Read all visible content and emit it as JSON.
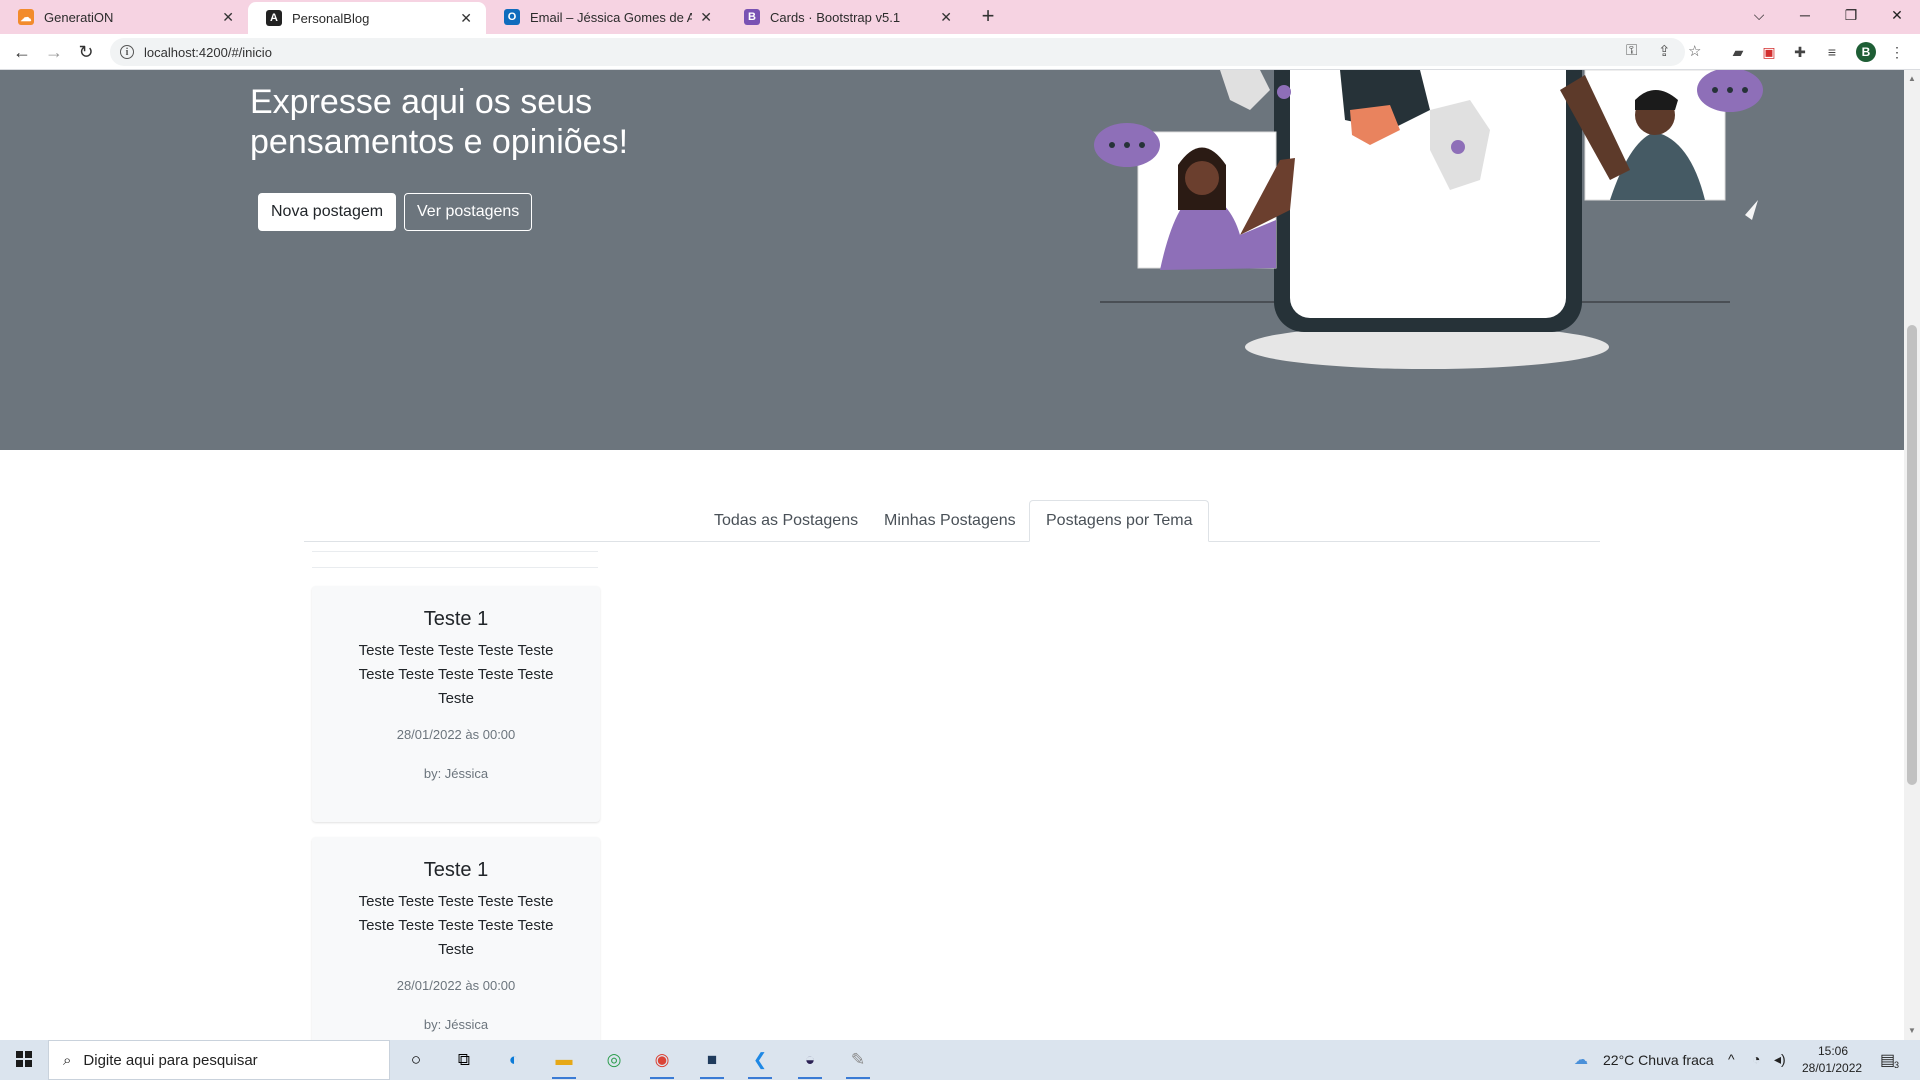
{
  "browser": {
    "tabs": [
      {
        "title": "GeneratiON",
        "icon": "cloud-icon",
        "color": "#f28b2c"
      },
      {
        "title": "PersonalBlog",
        "icon": "angular-icon",
        "color": "#222222"
      },
      {
        "title": "Email – Jéssica Gomes de Almeida",
        "icon": "outlook-icon",
        "color": "#0f6cbd"
      },
      {
        "title": "Cards · Bootstrap v5.1",
        "icon": "bootstrap-icon",
        "color": "#7952b3"
      }
    ],
    "url": "localhost:4200/#/inicio",
    "profile_initial": "B",
    "accent": "#f6d3e2"
  },
  "hero": {
    "title": "Expresse aqui os seus pensamentos e opiniões!",
    "primary_button": "Nova postagem",
    "secondary_button": "Ver postagens",
    "background": "#6c757d"
  },
  "tabs_nav": {
    "items": [
      "Todas as Postagens",
      "Minhas Postagens",
      "Postagens por Tema"
    ],
    "active": "Postagens por Tema"
  },
  "posts": [
    {
      "title": "Teste 1",
      "text": "Teste Teste Teste Teste Teste Teste Teste Teste Teste Teste Teste",
      "date": "28/01/2022 às 00:00",
      "author": "by: Jéssica"
    },
    {
      "title": "Teste 1",
      "text": "Teste Teste Teste Teste Teste Teste Teste Teste Teste Teste Teste",
      "date": "28/01/2022 às 00:00",
      "author": "by: Jéssica"
    }
  ],
  "taskbar": {
    "search_placeholder": "Digite aqui para pesquisar",
    "weather": "22°C  Chuva fraca",
    "time": "15:06",
    "date": "28/01/2022",
    "notifications": "3"
  }
}
